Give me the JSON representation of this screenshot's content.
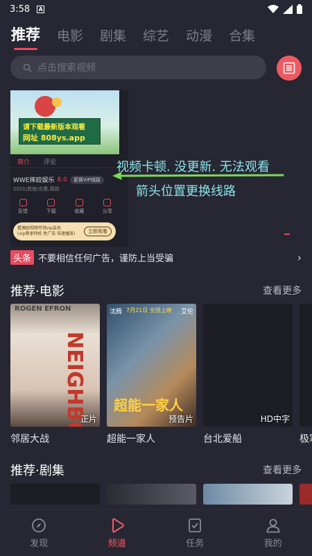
{
  "status_bar": {
    "time": "3:58",
    "icons": [
      "notification-a-icon",
      "wifi-icon",
      "signal-icon",
      "battery-icon"
    ]
  },
  "top_tabs": [
    {
      "label": "推荐",
      "active": true
    },
    {
      "label": "电影",
      "active": false
    },
    {
      "label": "剧集",
      "active": false
    },
    {
      "label": "综艺",
      "active": false
    },
    {
      "label": "动漫",
      "active": false
    },
    {
      "label": "合集",
      "active": false
    }
  ],
  "search": {
    "placeholder": "点击搜索视频",
    "history_icon": "list-icon"
  },
  "ad": {
    "banner_line1": "请下载最新版本观看",
    "banner_line2": "网址 808ys.app",
    "tab_intro": "简介",
    "tab_comment": "评论",
    "title": "WWE摔跤娱乐",
    "score": "8.0",
    "vip_label": "更换VIP线路",
    "meta": "2021/其他/合集,摔跤",
    "actions": [
      "反馈",
      "下载",
      "收藏",
      "分享"
    ],
    "vip_promo": "看激励视频可领vip会员",
    "vip_promo_sub": "(vip尊享特权 免广告 倍速播放)",
    "vip_button": "立即观看"
  },
  "annotations": {
    "line1": "视频卡顿. 没更新. 无法观看",
    "line2": "箭头位置更换线路"
  },
  "notice": {
    "badge": "头条",
    "text": "不要相信任何广告，谨防上当受骗"
  },
  "movies_section": {
    "title": "推荐·电影",
    "more": "查看更多",
    "items": [
      {
        "name": "邻居大战",
        "tag": "正片"
      },
      {
        "name": "超能一家人",
        "tag": "预告片"
      },
      {
        "name": "台北爱船",
        "tag": "HD中字"
      },
      {
        "name": "极寒",
        "tag": ""
      }
    ]
  },
  "series_section": {
    "title": "推荐·剧集",
    "more": "查看更多"
  },
  "posters": {
    "p1_top": "ROGEN   EFRON",
    "p1_word": "NEIGHBORS",
    "p2_date": "7月21日 全国上映",
    "p2_logo": "超能一家人",
    "p2_name_left": "沈腾",
    "p2_name_right": "艾伦"
  },
  "bottom_nav": [
    {
      "label": "发现",
      "icon": "compass-icon",
      "active": false
    },
    {
      "label": "频道",
      "icon": "play-icon",
      "active": true
    },
    {
      "label": "任务",
      "icon": "task-check-icon",
      "active": false
    },
    {
      "label": "我的",
      "icon": "user-icon",
      "active": false
    }
  ],
  "colors": {
    "background": "#262733",
    "accent": "#e84a5f",
    "annotation": "#8ee3e8",
    "search_bg": "#3d3e49"
  }
}
